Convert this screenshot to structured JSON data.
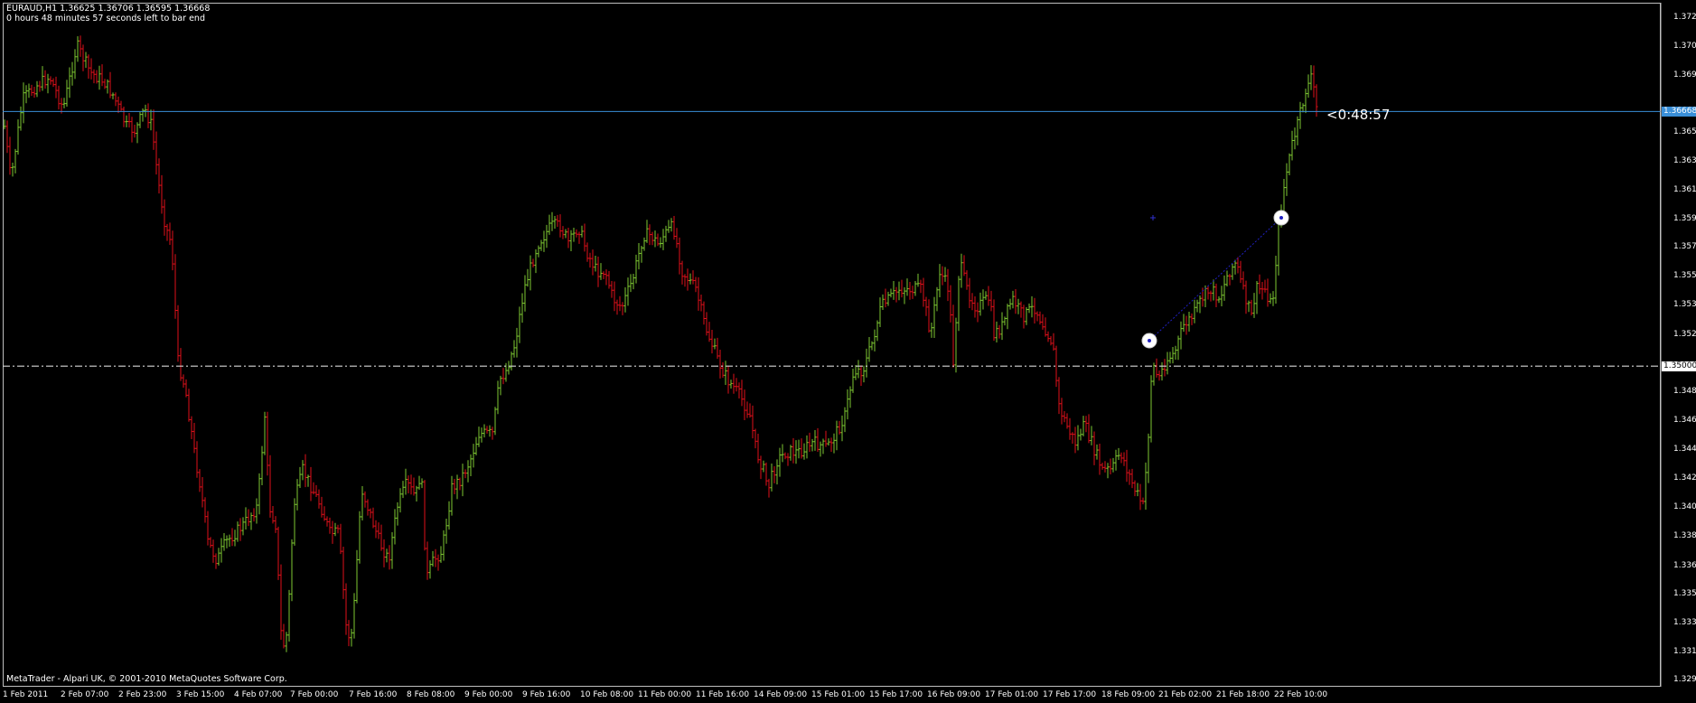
{
  "chart": {
    "symbol_line": "EURAUD,H1  1.36625 1.36706 1.36595 1.36668",
    "countdown_line": "0 hours 48 minutes 57 seconds left to bar end",
    "countdown_label": "<0:48:57",
    "copyright": "MetaTrader - Alpari UK, © 2001-2010 MetaQuotes Software Corp.",
    "bid_line_price": "1.36668",
    "hline_price": "1.35000",
    "price_ticks": [
      "1.37280",
      "1.37090",
      "1.36900",
      "1.36530",
      "1.36340",
      "1.36150",
      "1.35960",
      "1.35775",
      "1.35585",
      "1.35395",
      "1.35205",
      "1.34830",
      "1.34640",
      "1.34450",
      "1.34260",
      "1.34070",
      "1.33880",
      "1.33690",
      "1.33505",
      "1.33315",
      "1.33125",
      "1.32940"
    ],
    "time_ticks": [
      "1 Feb 2011",
      "2 Feb 07:00",
      "2 Feb 23:00",
      "3 Feb 15:00",
      "4 Feb 07:00",
      "7 Feb 00:00",
      "7 Feb 16:00",
      "8 Feb 08:00",
      "9 Feb 00:00",
      "9 Feb 16:00",
      "10 Feb 08:00",
      "11 Feb 00:00",
      "11 Feb 16:00",
      "14 Feb 09:00",
      "15 Feb 01:00",
      "15 Feb 17:00",
      "16 Feb 09:00",
      "17 Feb 01:00",
      "17 Feb 17:00",
      "18 Feb 09:00",
      "21 Feb 02:00",
      "21 Feb 18:00",
      "22 Feb 10:00"
    ]
  },
  "colors": {
    "background": "#000000",
    "bull_bar": "#7ec832",
    "bear_bar": "#e0101a",
    "bid_line": "#3a8fd8",
    "level_line": "#d8d8d8",
    "trend_line": "#2020c0",
    "bid_tag_bg": "#3a8fd8",
    "level_tag_bg": "#ffffff"
  }
}
